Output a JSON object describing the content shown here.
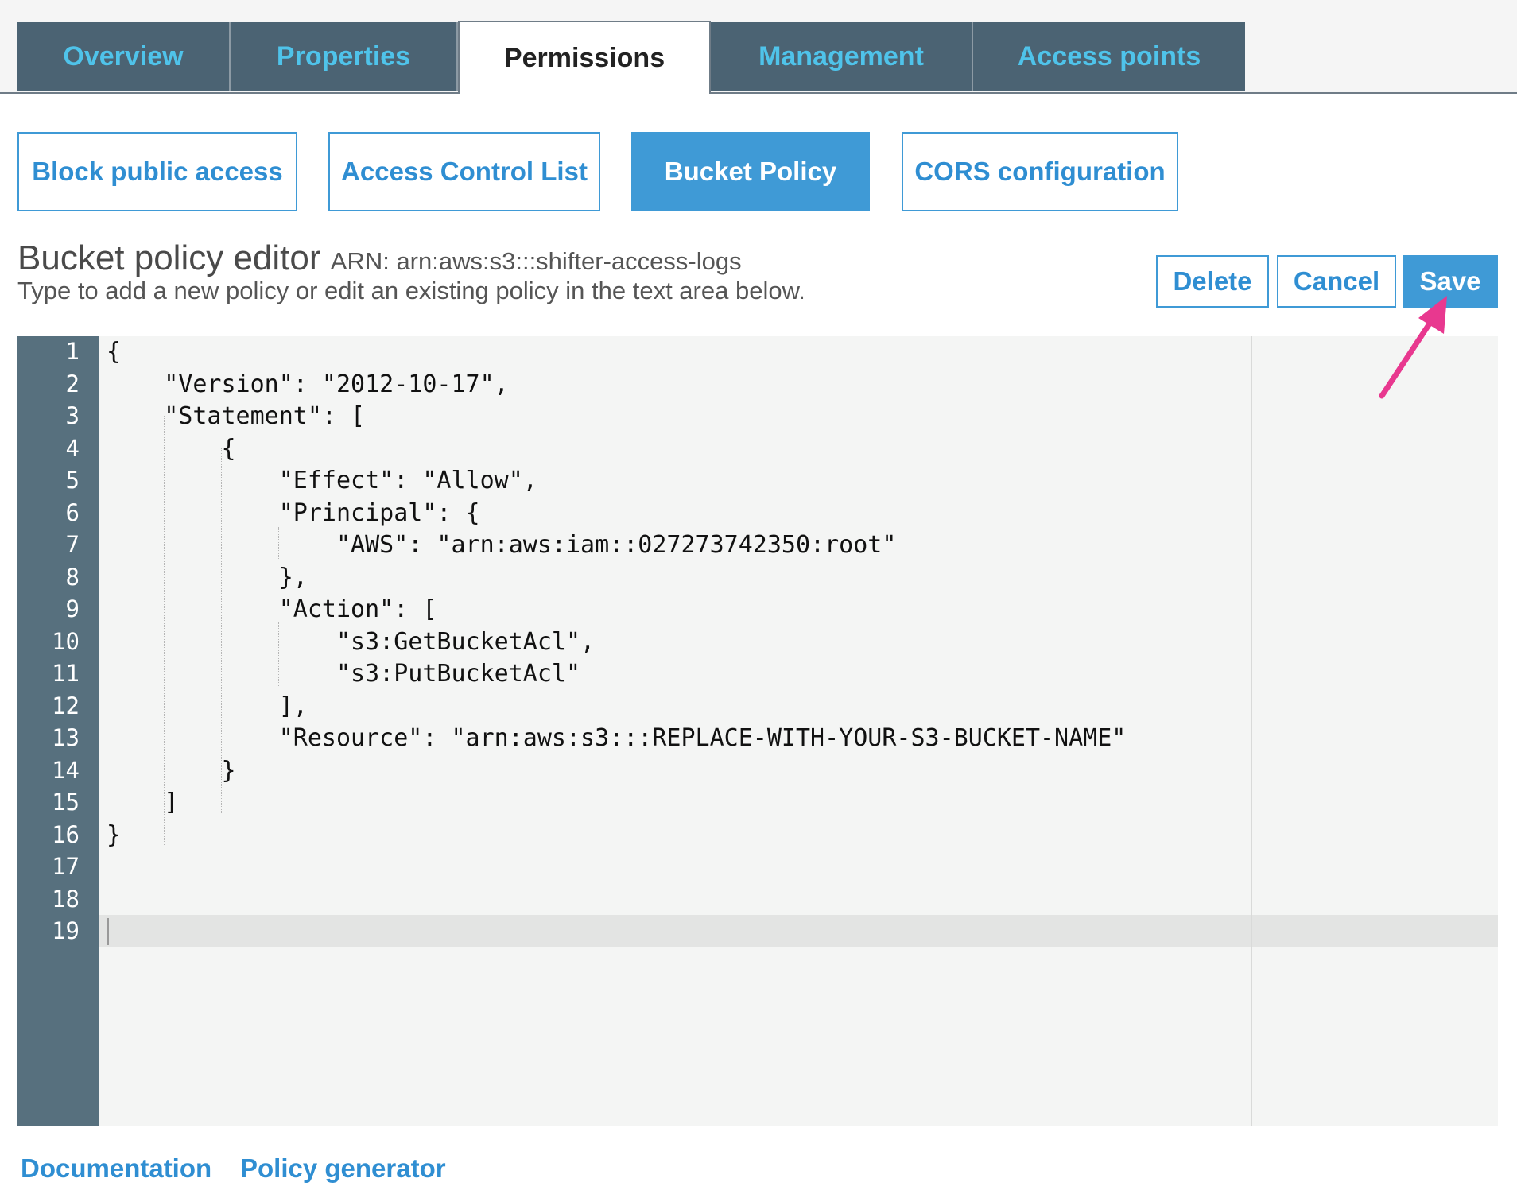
{
  "tabs": [
    "Overview",
    "Properties",
    "Permissions",
    "Management",
    "Access points"
  ],
  "active_tab": "Permissions",
  "subtabs": [
    "Block public access",
    "Access Control List",
    "Bucket Policy",
    "CORS configuration"
  ],
  "active_subtab": "Bucket Policy",
  "editor": {
    "title": "Bucket policy editor",
    "arn": "ARN: arn:aws:s3:::shifter-access-logs",
    "subtitle": "Type to add a new policy or edit an existing policy in the text area below.",
    "line_numbers": [
      "1",
      "2",
      "3",
      "4",
      "5",
      "6",
      "7",
      "8",
      "9",
      "10",
      "11",
      "12",
      "13",
      "14",
      "15",
      "16",
      "17",
      "18",
      "19"
    ],
    "code_lines": [
      "{",
      "    \"Version\": \"2012-10-17\",",
      "    \"Statement\": [",
      "        {",
      "            \"Effect\": \"Allow\",",
      "            \"Principal\": {",
      "                \"AWS\": \"arn:aws:iam::027273742350:root\"",
      "            },",
      "            \"Action\": [",
      "                \"s3:GetBucketAcl\",",
      "                \"s3:PutBucketAcl\"",
      "            ],",
      "            \"Resource\": \"arn:aws:s3:::REPLACE-WITH-YOUR-S3-BUCKET-NAME\"",
      "        }",
      "    ]",
      "}",
      "",
      "",
      ""
    ]
  },
  "buttons": {
    "delete": "Delete",
    "cancel": "Cancel",
    "save": "Save"
  },
  "footer": {
    "documentation": "Documentation",
    "policy_generator": "Policy generator"
  },
  "colors": {
    "tab_bg": "#4b6373",
    "tab_text": "#4fc3ea",
    "accent": "#3f9ad6",
    "arrow": "#e8388f",
    "gutter": "#57707e"
  },
  "annotation": {
    "icon": "arrow-pointer-icon"
  }
}
